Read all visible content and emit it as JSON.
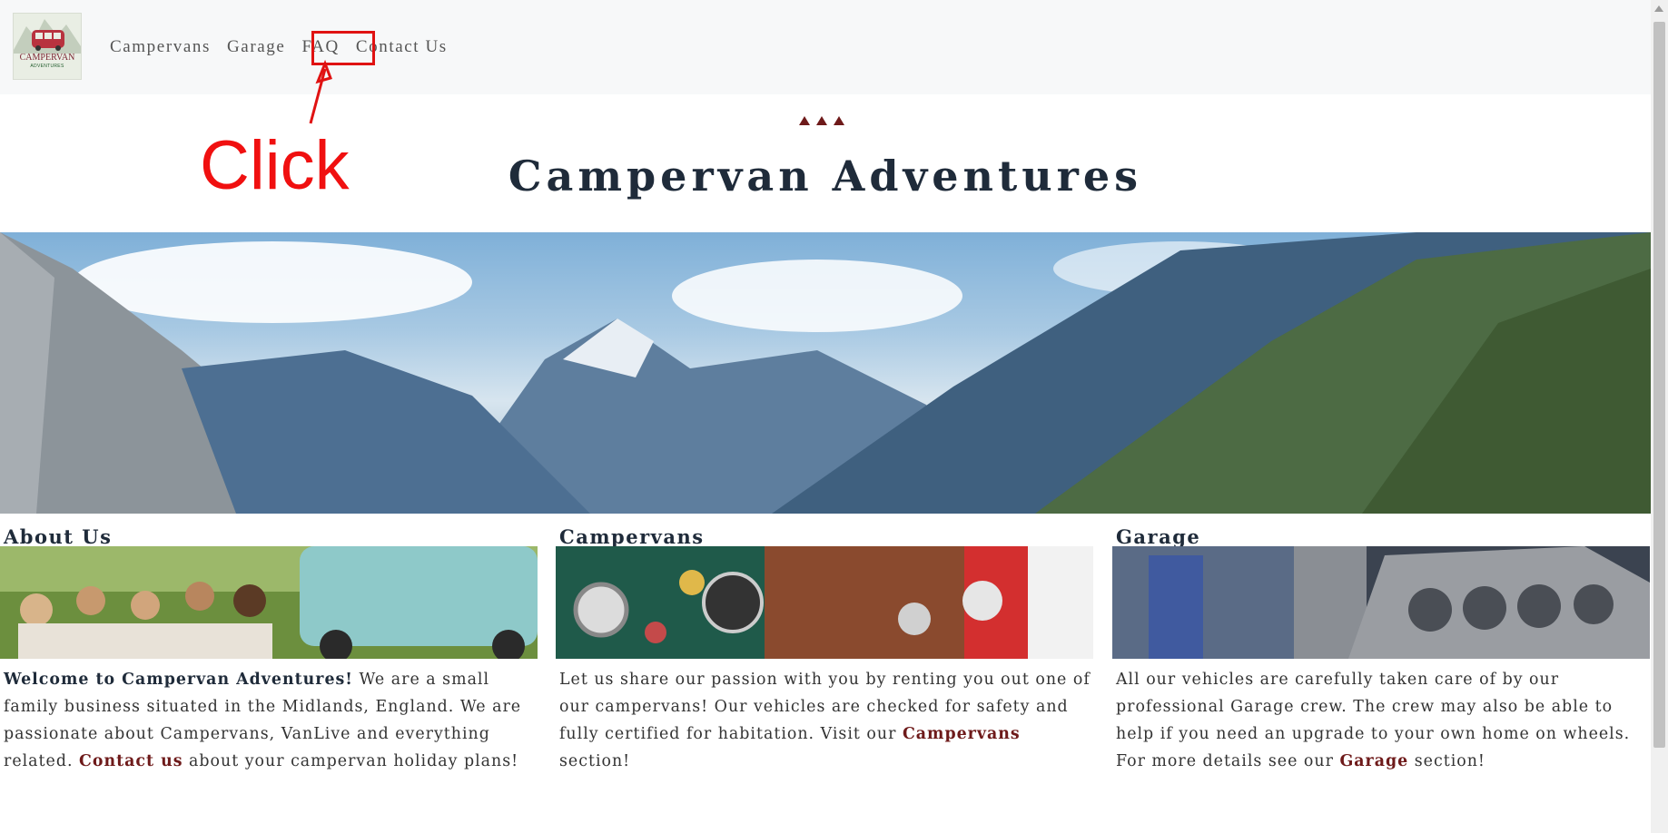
{
  "navbar": {
    "logo": {
      "text": "CAMPERVAN",
      "subtext": "ADVENTURES",
      "icon": "van-icon"
    },
    "links": [
      {
        "label": "Campervans"
      },
      {
        "label": "Garage"
      },
      {
        "label": "FAQ"
      },
      {
        "label": "Contact Us"
      }
    ]
  },
  "annotation": {
    "click_label": "Click"
  },
  "header": {
    "title": "Campervan Adventures"
  },
  "columns": [
    {
      "title": "About Us",
      "intro_bold": "Welcome to Campervan Adventures!",
      "text_before_link": " We are a small family business situated in the Midlands, England. We are passionate about Campervans, VanLive and everything related. ",
      "link": "Contact us",
      "text_after_link": " about your campervan holiday plans!"
    },
    {
      "title": "Campervans",
      "text_before_link": "Let us share our passion with you by renting you out one of our campervans! Our vehicles are checked for safety and fully certified for habitation. Visit our ",
      "link": "Campervans",
      "text_after_link": " section!"
    },
    {
      "title": "Garage",
      "text_before_link": "All our vehicles are carefully taken care of by our professional Garage crew. The crew may also be able to help if you need an upgrade to your own home on wheels. For more details see our ",
      "link": "Garage",
      "text_after_link": " section!"
    }
  ],
  "colors": {
    "accent": "#6e1a1a",
    "title": "#1f2b3a",
    "annotation": "#e01212"
  }
}
